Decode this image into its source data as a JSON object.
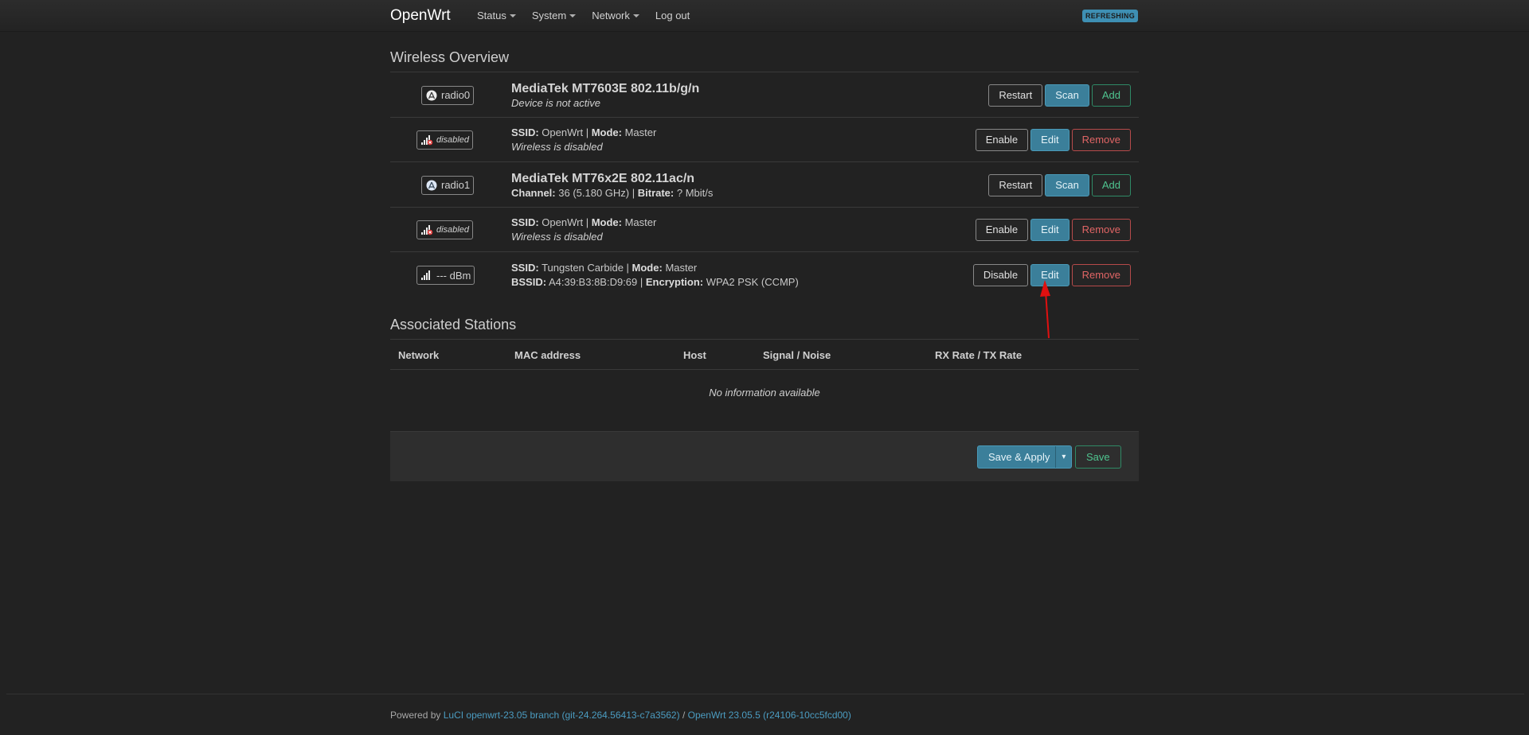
{
  "header": {
    "brand": "OpenWrt",
    "menu": [
      {
        "label": "Status",
        "has_dropdown": true
      },
      {
        "label": "System",
        "has_dropdown": true
      },
      {
        "label": "Network",
        "has_dropdown": true
      },
      {
        "label": "Log out",
        "has_dropdown": false
      }
    ],
    "refresh_badge": "REFRESHING"
  },
  "wireless": {
    "title": "Wireless Overview",
    "rows": [
      {
        "badge_label": "radio0",
        "badge_icon": "wifi-radio-icon",
        "title": "MediaTek MT7603E 802.11b/g/n",
        "line2": "Device is not active",
        "buttons": [
          "Restart",
          "Scan",
          "Add"
        ]
      },
      {
        "badge_label": "disabled",
        "badge_icon": "signal-disabled-icon",
        "ssid_label": "SSID:",
        "ssid": "OpenWrt",
        "mode_label": "Mode:",
        "mode": "Master",
        "line2": "Wireless is disabled",
        "buttons": [
          "Enable",
          "Edit",
          "Remove"
        ]
      },
      {
        "badge_label": "radio1",
        "badge_icon": "wifi-radio-icon",
        "title": "MediaTek MT76x2E 802.11ac/n",
        "channel_label": "Channel:",
        "channel": "36 (5.180 GHz)",
        "bitrate_label": "Bitrate:",
        "bitrate": "? Mbit/s",
        "buttons": [
          "Restart",
          "Scan",
          "Add"
        ]
      },
      {
        "badge_label": "disabled",
        "badge_icon": "signal-disabled-icon",
        "ssid_label": "SSID:",
        "ssid": "OpenWrt",
        "mode_label": "Mode:",
        "mode": "Master",
        "line2": "Wireless is disabled",
        "buttons": [
          "Enable",
          "Edit",
          "Remove"
        ]
      },
      {
        "badge_label": "--- dBm",
        "badge_icon": "signal-strength-icon",
        "ssid_label": "SSID:",
        "ssid": "Tungsten Carbide",
        "mode_label": "Mode:",
        "mode": "Master",
        "bssid_label": "BSSID:",
        "bssid": "A4:39:B3:8B:D9:69",
        "encryption_label": "Encryption:",
        "encryption": "WPA2 PSK (CCMP)",
        "buttons": [
          "Disable",
          "Edit",
          "Remove"
        ]
      }
    ]
  },
  "stations": {
    "title": "Associated Stations",
    "columns": [
      "Network",
      "MAC address",
      "Host",
      "Signal / Noise",
      "RX Rate / TX Rate"
    ],
    "empty_text": "No information available"
  },
  "actions": {
    "save_apply": "Save & Apply",
    "dropdown_glyph": "▾",
    "save": "Save"
  },
  "footer": {
    "powered_by": "Powered by",
    "luci_link": "LuCI openwrt-23.05 branch (git-24.264.56413-c7a3562)",
    "separator": "/",
    "openwrt_link": "OpenWrt 23.05.5 (r24106-10cc5fcd00)"
  },
  "colors": {
    "background": "#222222",
    "primary": "#3b7f9a",
    "positive": "#4fc48f",
    "negative": "#e06565",
    "link": "#4b9cc1",
    "annotation_arrow": "#e01010"
  }
}
